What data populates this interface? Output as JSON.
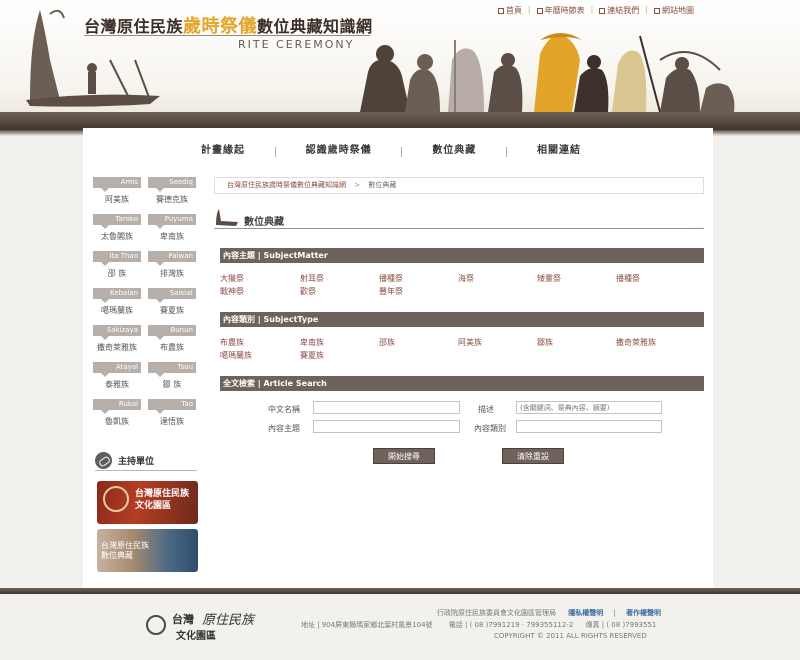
{
  "header": {
    "title_part1": "台灣原住民族",
    "title_highlight": "歲時祭儀",
    "title_part2": "數位典藏知識網",
    "subtitle": "RITE CEREMONY",
    "top_links": [
      "首頁",
      "年曆時節表",
      "連結我們",
      "網站地圖"
    ]
  },
  "nav": {
    "items": [
      "計畫緣起",
      "認識歲時祭儀",
      "數位典藏",
      "相關連結"
    ]
  },
  "sidebar": {
    "tribes": [
      {
        "tag": "Amis",
        "name": "阿美族"
      },
      {
        "tag": "Seediq",
        "name": "賽德克族"
      },
      {
        "tag": "Taroko",
        "name": "太魯閣族"
      },
      {
        "tag": "Puyuma",
        "name": "卑南族"
      },
      {
        "tag": "Ita Thao",
        "name": "邵 族"
      },
      {
        "tag": "Paiwan",
        "name": "排灣族"
      },
      {
        "tag": "Kebalan",
        "name": "噶瑪蘭族"
      },
      {
        "tag": "Saisiat",
        "name": "賽夏族"
      },
      {
        "tag": "Sakizaya",
        "name": "撒奇萊雅族"
      },
      {
        "tag": "Bunun",
        "name": "布農族"
      },
      {
        "tag": "Atayal",
        "name": "泰雅族"
      },
      {
        "tag": "Tsou",
        "name": "鄒 族"
      },
      {
        "tag": "Rukai",
        "name": "魯凱族"
      },
      {
        "tag": "Tao",
        "name": "達悟族"
      }
    ],
    "org_title": "主持單位",
    "banner1": [
      "台灣原住民族",
      "文化園區"
    ],
    "banner2": [
      "台灣原住民族",
      "數位典藏"
    ]
  },
  "breadcrumb": {
    "home": "台灣原住民族歲時祭儀數位典藏知識網",
    "sep": ">",
    "current": "數位典藏"
  },
  "section": {
    "title": "數位典藏",
    "more": "..."
  },
  "subject_matter": {
    "header": "內容主題 | SubjectMatter",
    "items": [
      "大獵祭",
      "射耳祭",
      "播種祭",
      "海祭",
      "矮靈祭",
      "播種祭",
      "戰神祭",
      "歡祭",
      "豐年祭"
    ]
  },
  "subject_type": {
    "header": "內容類別 | SubjectType",
    "items": [
      "布農族",
      "卑南族",
      "邵族",
      "阿美族",
      "鄒族",
      "撒奇萊雅族",
      "噶瑪蘭族",
      "賽夏族"
    ]
  },
  "search": {
    "header": "全文檢索 | Article Search",
    "label_name": "中文名稱",
    "label_desc": "描述",
    "label_subject": "內容主題",
    "label_type": "內容類別",
    "desc_placeholder": "(含關鍵詞、祭典內容、摘要)",
    "submit_label": "開始搜尋",
    "reset_label": "清除重設"
  },
  "footer": {
    "logo_a": "台灣",
    "logo_b": "原住民族",
    "logo_c": "文化園區",
    "agency": "行政院原住民族委員會文化園區管理局",
    "privacy": "隱私權聲明",
    "sep": "|",
    "copyright_link": "著作權聲明",
    "address": "地址 | 904屏東縣瑪家鄉北葉村風景104號",
    "phone": "電話 | ( 08 )7991219 · 799355112-2",
    "fax": "傳真 | ( 08 )7993551",
    "copyright": "COPYRIGHT © 2011 ALL RIGHTS RESERVED"
  },
  "colors": {
    "accent": "#e2a52a",
    "bar": "#6e625b",
    "link": "#8a4c3e"
  }
}
